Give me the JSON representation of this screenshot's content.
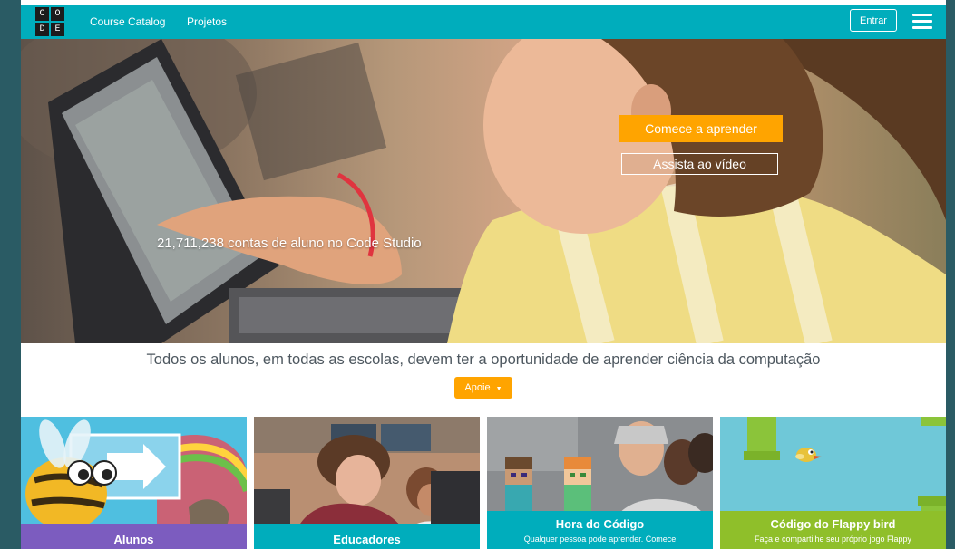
{
  "nav": {
    "logo_letters": [
      "C",
      "O",
      "D",
      "E"
    ],
    "links": [
      "Course Catalog",
      "Projetos"
    ],
    "signin_label": "Entrar",
    "menu_icon": "hamburger-menu-icon"
  },
  "hero": {
    "stat_text": "21,711,238 contas de aluno no Code Studio",
    "learn_button": "Comece a aprender",
    "video_button": "Assista ao vídeo"
  },
  "tagline": {
    "text": "Todos os alunos, em todas as escolas, devem ter a oportunidade de aprender ciência da computação",
    "support_button": "Apoie"
  },
  "cards": [
    {
      "title": "Alunos",
      "subtitle": "",
      "band_color": "#7c5cbf"
    },
    {
      "title": "Educadores",
      "subtitle": "",
      "band_color": "#00adbc"
    },
    {
      "title": "Hora do Código",
      "subtitle": "Qualquer pessoa pode aprender. Comece",
      "band_color": "#00adbc"
    },
    {
      "title": "Código do Flappy bird",
      "subtitle": "Faça e compartilhe seu próprio jogo Flappy",
      "band_color": "#8fbf2a"
    }
  ],
  "colors": {
    "brand_teal": "#00adbc",
    "accent_orange": "#ffa400",
    "students_purple": "#7c5cbf",
    "flappy_green": "#8fbf2a"
  }
}
